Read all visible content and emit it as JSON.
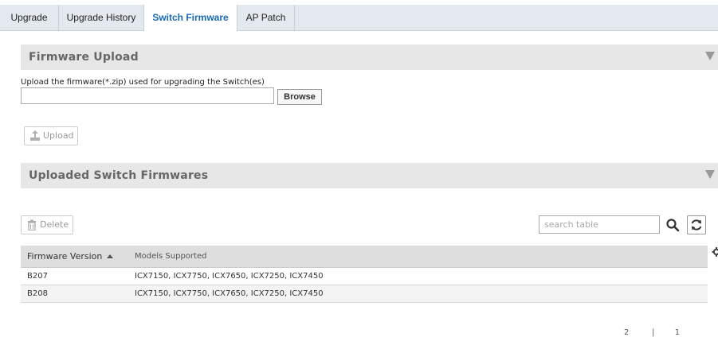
{
  "tabs": [
    {
      "label": "Upgrade"
    },
    {
      "label": "Upgrade History"
    },
    {
      "label": "Switch Firmware",
      "active": true
    },
    {
      "label": "AP Patch"
    }
  ],
  "firmware_upload": {
    "title": "Firmware Upload",
    "description": "Upload the firmware(*.zip) used for upgrading the Switch(es)",
    "file_value": "",
    "browse_label": "Browse",
    "upload_label": "Upload"
  },
  "uploaded": {
    "title": "Uploaded Switch Firmwares",
    "delete_label": "Delete",
    "search_placeholder": "search table",
    "columns": [
      "Firmware Version",
      "Models Supported"
    ],
    "rows": [
      {
        "version": "B207",
        "models": "ICX7150, ICX7750, ICX7650, ICX7250, ICX7450"
      },
      {
        "version": "B208",
        "models": "ICX7150, ICX7750, ICX7650, ICX7250, ICX7450"
      }
    ],
    "footer_clip": "2         |        1"
  },
  "colors": {
    "accent": "#1a69b5",
    "header_bg": "#e7e7e7",
    "tab_bg": "#e4e8ef"
  },
  "icons": {
    "collapse": "triangle-down-icon",
    "upload": "upload-icon",
    "delete": "trash-icon",
    "search": "search-icon",
    "refresh": "refresh-icon",
    "settings": "gear-icon"
  }
}
